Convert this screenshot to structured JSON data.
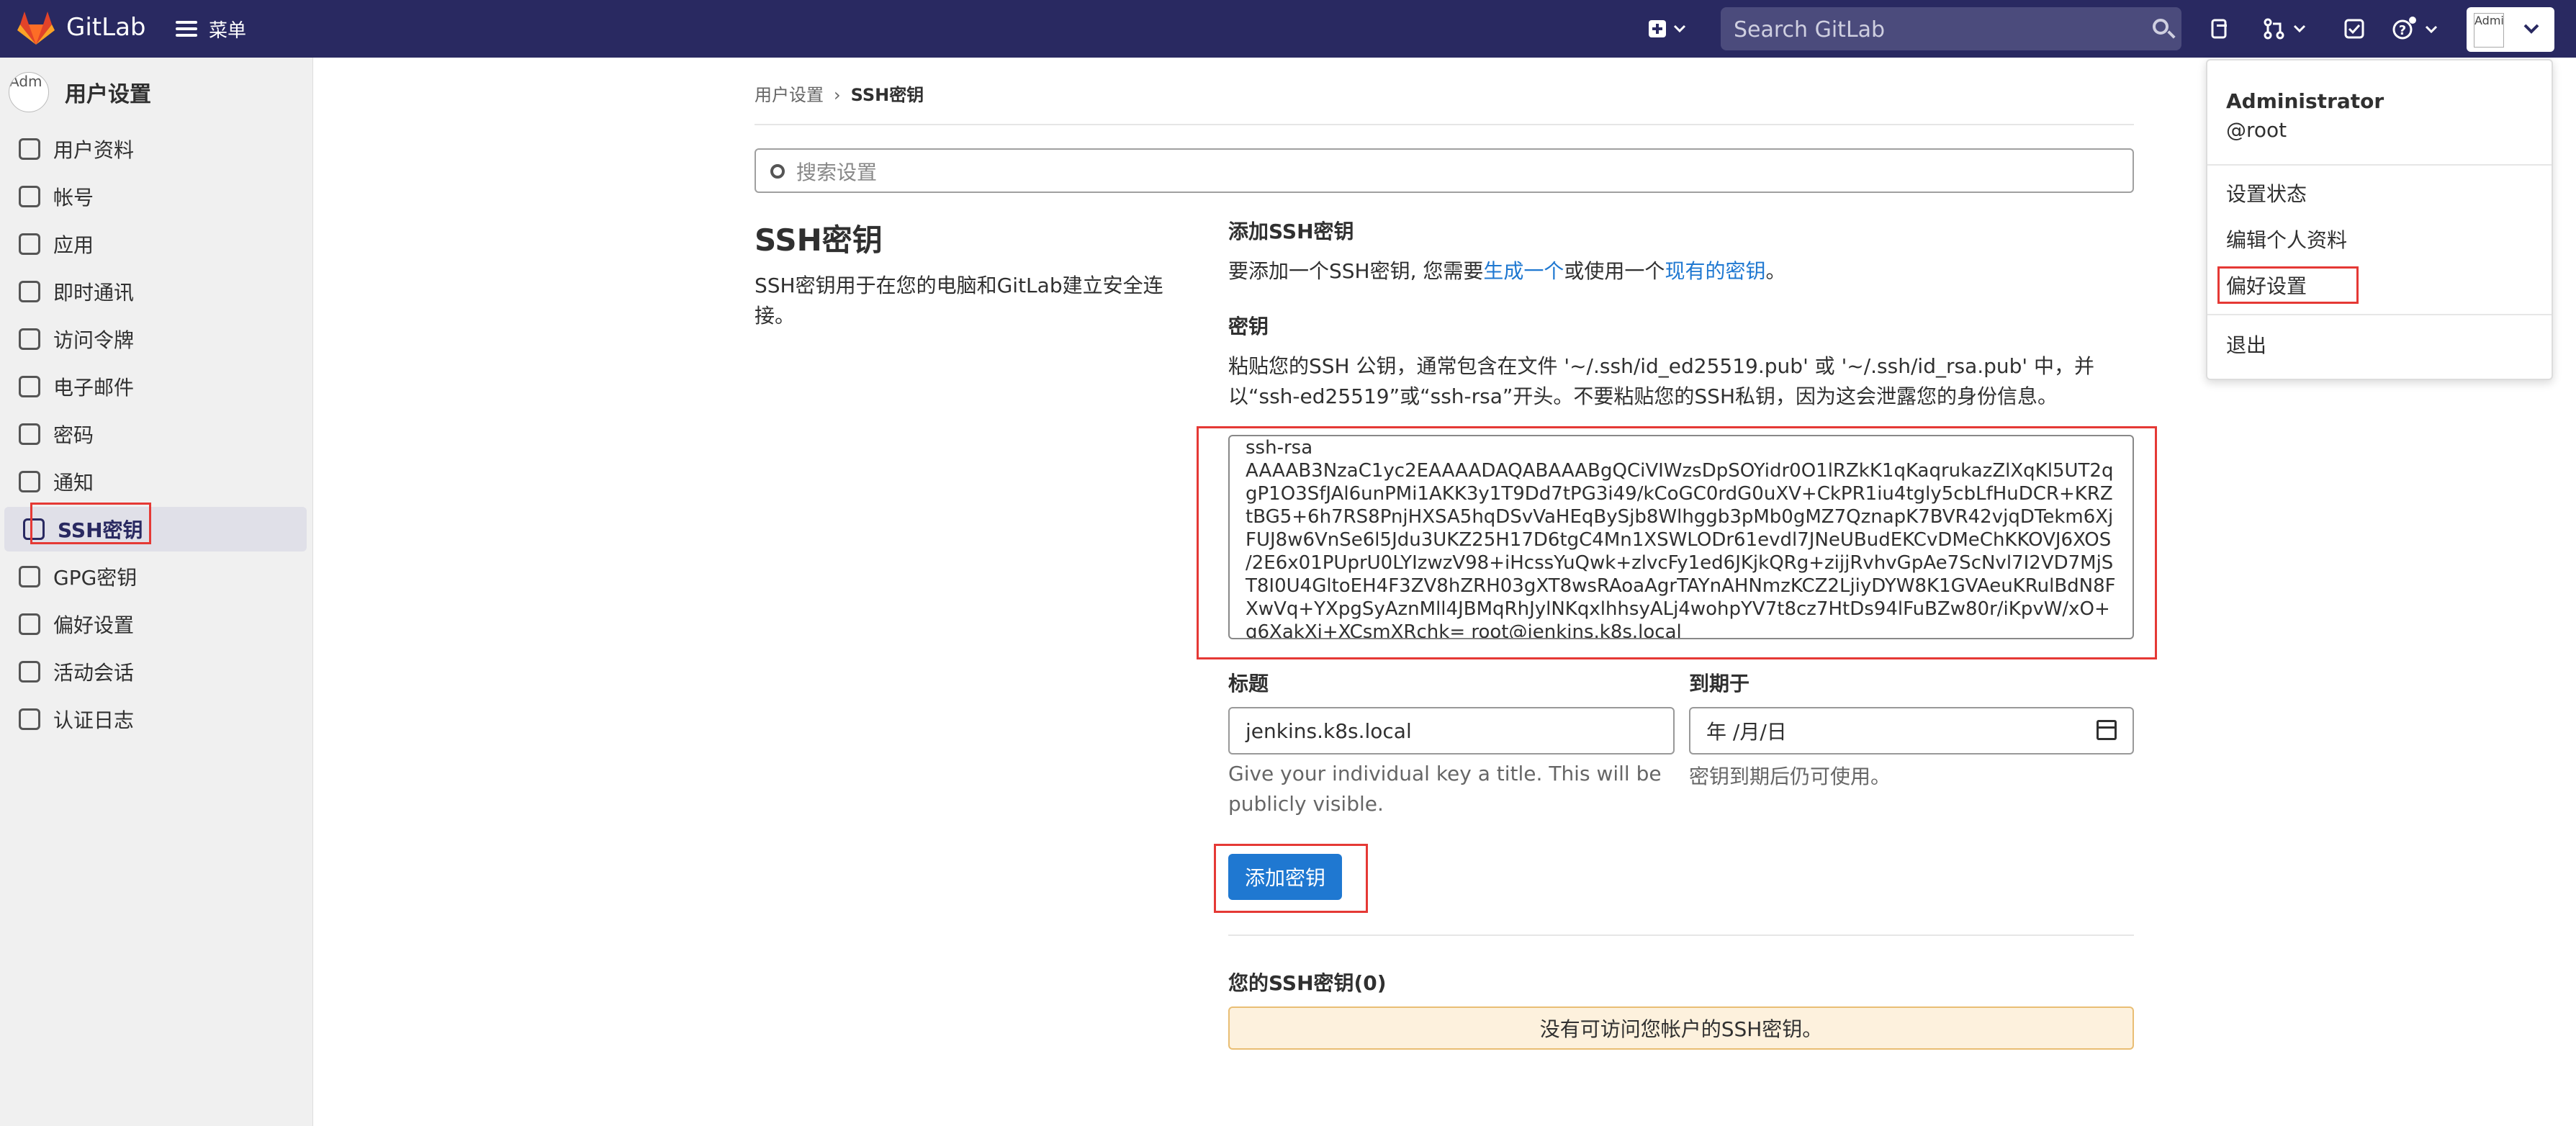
{
  "app": {
    "name": "GitLab",
    "menu_label": "菜单"
  },
  "topbar": {
    "search_placeholder": "Search GitLab",
    "avatar_text": "Adminis"
  },
  "sidebar": {
    "avatar_text": "Adm",
    "title": "用户设置",
    "items": [
      {
        "label": "用户资料",
        "icon": "user-icon"
      },
      {
        "label": "帐号",
        "icon": "account-icon"
      },
      {
        "label": "应用",
        "icon": "apps-icon"
      },
      {
        "label": "即时通讯",
        "icon": "chat-icon"
      },
      {
        "label": "访问令牌",
        "icon": "token-icon"
      },
      {
        "label": "电子邮件",
        "icon": "mail-icon"
      },
      {
        "label": "密码",
        "icon": "lock-icon"
      },
      {
        "label": "通知",
        "icon": "bell-icon"
      },
      {
        "label": "SSH密钥",
        "icon": "key-icon",
        "active": true
      },
      {
        "label": "GPG密钥",
        "icon": "key-icon"
      },
      {
        "label": "偏好设置",
        "icon": "preferences-icon"
      },
      {
        "label": "活动会话",
        "icon": "monitor-icon"
      },
      {
        "label": "认证日志",
        "icon": "log-icon"
      }
    ]
  },
  "breadcrumb": {
    "parent": "用户设置",
    "sep": "›",
    "current": "SSH密钥"
  },
  "settings_search_placeholder": "搜索设置",
  "section": {
    "title": "SSH密钥",
    "description": "SSH密钥用于在您的电脑和GitLab建立安全连接。"
  },
  "add_key": {
    "heading": "添加SSH密钥",
    "intro_prefix": "要添加一个SSH密钥, 您需要",
    "intro_link1": "生成一个",
    "intro_mid": "或使用一个",
    "intro_link2": "现有的密钥",
    "intro_suffix": "。",
    "key_label": "密钥",
    "key_help": "粘贴您的SSH 公钥，通常包含在文件 '~/.ssh/id_ed25519.pub' 或 '~/.ssh/id_rsa.pub' 中，并以“ssh-ed25519”或“ssh-rsa”开头。不要粘贴您的SSH私钥，因为这会泄露您的身份信息。",
    "key_value": "ssh-rsa\nAAAAB3NzaC1yc2EAAAADAQABAAABgQCiVIWzsDpSOYidr0O1lRZkK1qKaqrukazZlXqKl5UT2qgP1O3SfJAl6unPMi1AKK3y1T9Dd7tPG3i49/kCoGC0rdG0uXV+CkPR1iu4tgly5cbLfHuDCR+KRZtBG5+6h7RS8PnjHXSA5hqDSvVaHEqBySjb8Wlhggb3pMb0gMZ7QznapK7BVR42vjqDTekm6XjFUJ8w6VnSe6l5Jdu3UKZ25H17D6tgC4Mn1XSWLODr61evdl7JNeUBudEKCvDMeChKKOVJ6XOS/2E6x01PUprU0LYIzwzV98+iHcssYuQwk+zlvcFy1ed6JKjkQRg+zijjRvhvGpAe7ScNvl7I2VD7MjST8I0U4GltoEH4F3ZV8hZRH03gXT8wsRAoaAgrTAYnAHNmzKCZ2LjiyDYW8K1GVAeuKRulBdN8FXwVq+YXpgSyAznMll4JBMqRhJylNKqxlhhsyALj4wohpYV7t8cz7HtDs94lFuBZw80r/iKpvW/xO+q6XakXi+XCsmXRchk= root@jenkins.k8s.local",
    "title_label": "标题",
    "title_value": "jenkins.k8s.local",
    "title_hint": "Give your individual key a title. This will be publicly visible.",
    "expires_label": "到期于",
    "expires_value": "年 /月/日",
    "expires_hint": "密钥到期后仍可使用。",
    "submit_label": "添加密钥"
  },
  "your_keys": {
    "heading": "您的SSH密钥(0)",
    "empty_message": "没有可访问您帐户的SSH密钥。"
  },
  "user_dropdown": {
    "name": "Administrator",
    "username": "@root",
    "items": [
      "设置状态",
      "编辑个人资料",
      "偏好设置",
      "退出"
    ]
  },
  "colors": {
    "topbar": "#292961",
    "link": "#1f78d1",
    "primary": "#1f78d1",
    "highlight": "#e53935",
    "warning_bg": "#fdf1dd"
  }
}
